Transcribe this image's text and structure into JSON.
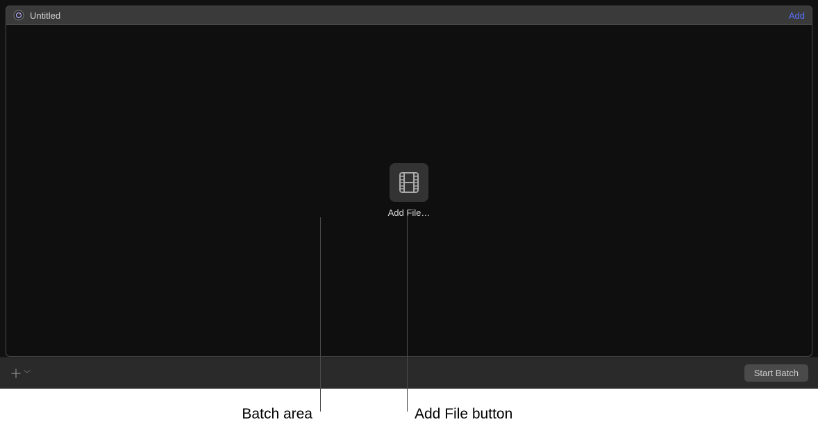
{
  "header": {
    "title": "Untitled",
    "add_label": "Add"
  },
  "batch": {
    "add_file_label": "Add File…"
  },
  "footer": {
    "start_batch_label": "Start Batch"
  },
  "annotations": {
    "batch_area": "Batch area",
    "add_file_button": "Add File button"
  }
}
